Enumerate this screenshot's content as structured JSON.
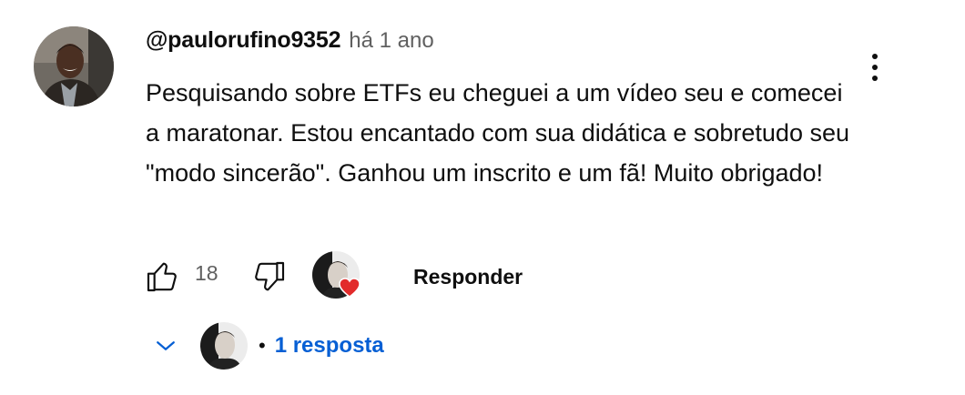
{
  "comment": {
    "author": "@paulorufino9352",
    "time": "há 1 ano",
    "text": "Pesquisando sobre ETFs eu cheguei a um vídeo seu e comecei a maratonar. Estou encantado com sua didática e sobretudo seu \"modo sincerão\". Ganhou um inscrito e um fã! Muito obrigado!",
    "like_count": "18",
    "reply_label": "Responder",
    "replies_label": "1 resposta",
    "bullet": "•"
  },
  "icons": {
    "menu": "more-vert-icon",
    "like": "thumb-up-icon",
    "dislike": "thumb-down-icon",
    "creator_heart": "heart-icon",
    "expand": "chevron-down-icon"
  },
  "colors": {
    "text": "#0f0f0f",
    "secondary": "#606060",
    "link": "#065fd4",
    "heart": "#e22b2b"
  }
}
